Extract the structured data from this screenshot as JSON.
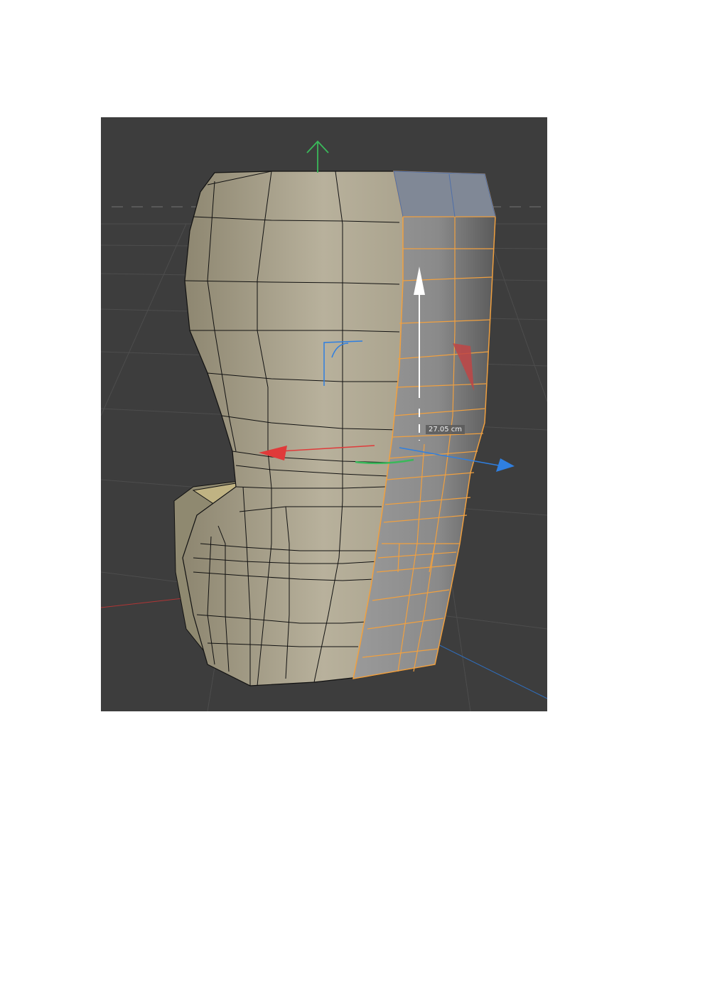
{
  "viewport": {
    "background_color": "#3d3d3d",
    "grid_color": "#4d4d4d",
    "mesh_color": "#a39c85",
    "mesh_wire_color": "#111111",
    "selection_color": "#f0a040",
    "selected_face_color": "#8e8e8e",
    "axis_colors": {
      "x": "#e03a3a",
      "y": "#3ab85a",
      "z": "#2f7fe0"
    }
  },
  "icons": [
    "move-y-arrow-icon",
    "move-x-arrow-icon",
    "move-z-arrow-icon",
    "rotate-handle-icon",
    "plane-handle-icon",
    "drag-arrow-icon"
  ],
  "measurement": {
    "readout": "27.05 cm"
  }
}
